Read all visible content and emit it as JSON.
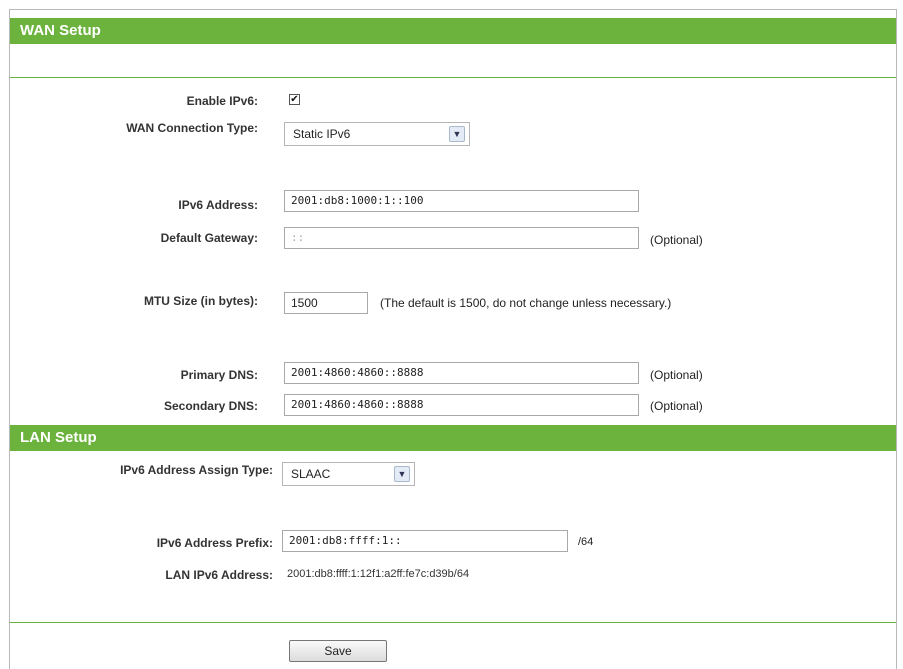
{
  "wan": {
    "title": "WAN Setup",
    "enable_ipv6": {
      "label": "Enable IPv6:",
      "checked": true,
      "mark": "✔"
    },
    "connection_type": {
      "label": "WAN Connection Type:",
      "value": "Static IPv6",
      "arrow": "▼"
    },
    "ipv6_address": {
      "label": "IPv6 Address:",
      "value": "2001:db8:1000:1::100"
    },
    "default_gateway": {
      "label": "Default Gateway:",
      "placeholder": "::",
      "note": "(Optional)"
    },
    "mtu": {
      "label": "MTU Size (in bytes):",
      "value": "1500",
      "note": "(The default is 1500, do not change unless necessary.)"
    },
    "primary_dns": {
      "label": "Primary DNS:",
      "value": "2001:4860:4860::8888",
      "note": "(Optional)"
    },
    "secondary_dns": {
      "label": "Secondary DNS:",
      "value": "2001:4860:4860::8888",
      "note": "(Optional)"
    }
  },
  "lan": {
    "title": "LAN Setup",
    "assign_type": {
      "label": "IPv6 Address Assign Type:",
      "value": "SLAAC",
      "arrow": "▼"
    },
    "prefix": {
      "label": "IPv6 Address Prefix:",
      "value": "2001:db8:ffff:1::",
      "suffix": "/64"
    },
    "lan_address": {
      "label": "LAN IPv6 Address:",
      "value": "2001:db8:ffff:1:12f1:a2ff:fe7c:d39b/64"
    }
  },
  "footer": {
    "save_label": "Save"
  },
  "colors": {
    "accent_green": "#6cb33e"
  }
}
